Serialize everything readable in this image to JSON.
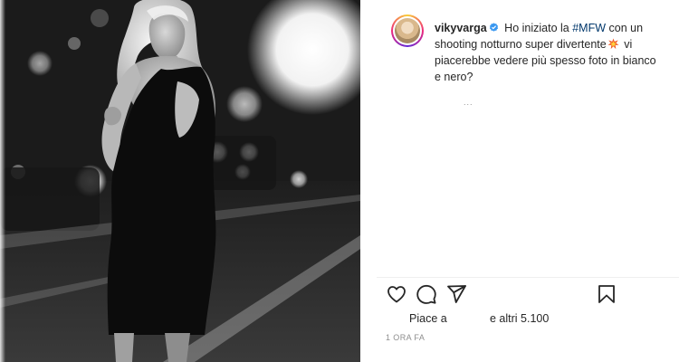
{
  "post": {
    "username": "vikyvarga",
    "caption_prefix": "Ho iniziato la",
    "caption_hashtag": "#MFW",
    "caption_mid": "con un shooting notturno super divertente",
    "caption_rest": "vi piacerebbe vedere più spesso foto in bianco e nero?",
    "more_indicator": "...",
    "likes_prefix": "Piace a",
    "likes_suffix": "e altri 5.100",
    "timestamp": "1 ORA FA"
  },
  "icons": {
    "verified": "verified-badge-icon",
    "emoji": "collision-emoji-icon",
    "like": "heart-icon",
    "comment": "comment-icon",
    "share": "share-paper-plane-icon",
    "save": "bookmark-icon"
  },
  "colors": {
    "text": "#262626",
    "secondary": "#8e8e8e",
    "hashtag": "#00376b",
    "verified": "#3897f0",
    "divider": "#efefef"
  }
}
